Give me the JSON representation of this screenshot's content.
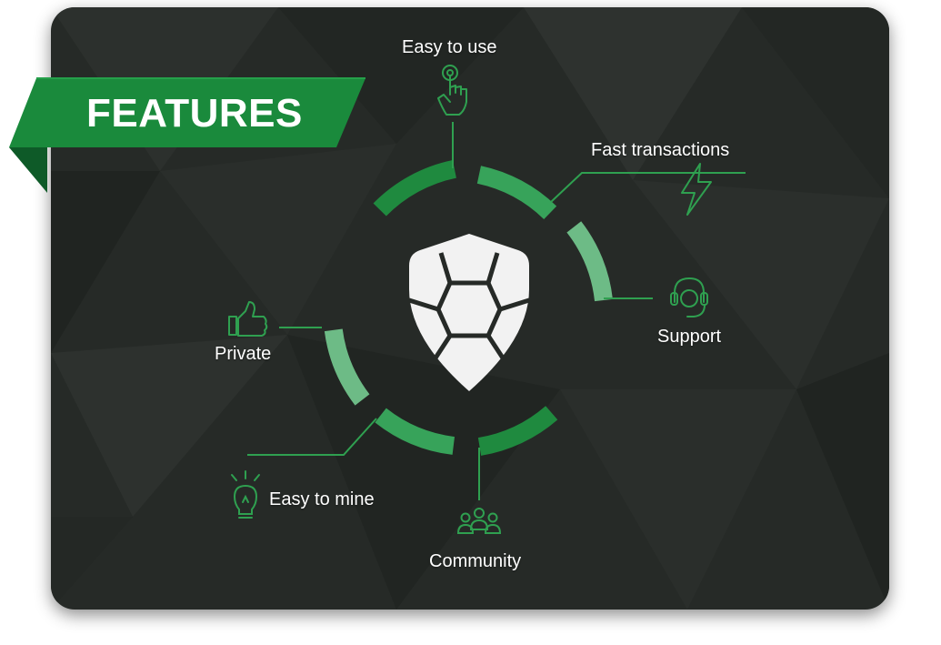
{
  "title": "FEATURES",
  "features": {
    "easy_to_use": {
      "label": "Easy to use",
      "icon": "touch-finger-icon"
    },
    "fast_transactions": {
      "label": "Fast transactions",
      "icon": "lightning-bolt-icon"
    },
    "support": {
      "label": "Support",
      "icon": "headset-icon"
    },
    "community": {
      "label": "Community",
      "icon": "people-group-icon"
    },
    "easy_to_mine": {
      "label": "Easy to mine",
      "icon": "lightbulb-icon"
    },
    "private": {
      "label": "Private",
      "icon": "thumbs-up-icon"
    }
  },
  "center_icon": "turtle-shell-shield-icon",
  "colors": {
    "background": "#262a27",
    "accent_dark": "#1f8a3f",
    "accent_mid": "#37a35a",
    "accent_light": "#6dbb86",
    "banner": "#1a8a3c",
    "text": "#ffffff"
  }
}
